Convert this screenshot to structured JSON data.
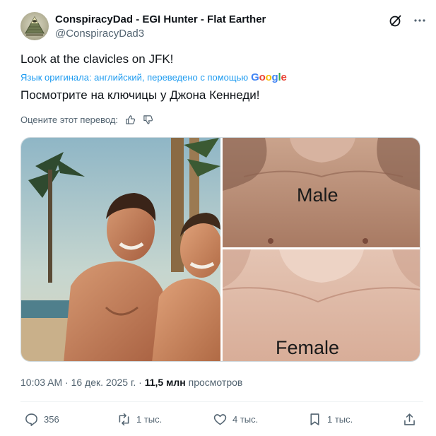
{
  "author": {
    "display_name": "ConspiracyDad - EGI Hunter - Flat Earther",
    "handle": "@ConspiracyDad3",
    "avatar_icon": "pyramid-eye-icon"
  },
  "tweet": {
    "text": "Look at the clavicles on JFK!",
    "translation_note": "Язык оригинала: английский, переведено с помощью",
    "translation_provider": "Google",
    "translated_text": "Посмотрите на ключицы у Джона Кеннеди!",
    "rate_prompt": "Оцените этот перевод:"
  },
  "media": {
    "label_top": "Male",
    "label_bottom": "Female"
  },
  "meta": {
    "time_date": "10:03 AM · 16 дек. 2025 г. · ",
    "views_count": "11,5 млн",
    "views_label": " просмотров"
  },
  "actions": {
    "replies": "356",
    "reposts": "1 тыс.",
    "likes": "4 тыс.",
    "bookmarks": "1 тыс."
  },
  "colors": {
    "link": "#1d9bf0",
    "secondary": "#536471",
    "primary": "#0f1419"
  }
}
